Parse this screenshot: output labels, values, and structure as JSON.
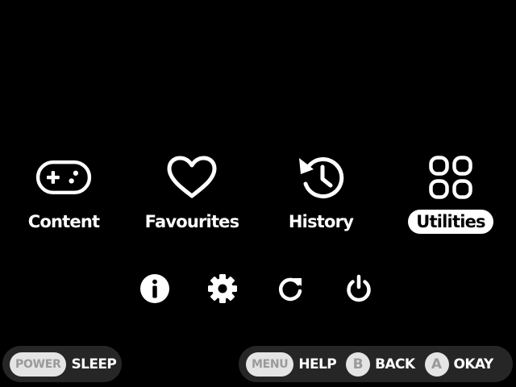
{
  "main_menu": {
    "items": [
      {
        "label": "Content",
        "icon": "gamepad-icon",
        "selected": false
      },
      {
        "label": "Favourites",
        "icon": "heart-icon",
        "selected": false
      },
      {
        "label": "History",
        "icon": "history-icon",
        "selected": false
      },
      {
        "label": "Utilities",
        "icon": "apps-grid-icon",
        "selected": true
      }
    ]
  },
  "quick_actions": [
    {
      "icon": "info-icon"
    },
    {
      "icon": "gear-icon"
    },
    {
      "icon": "refresh-icon"
    },
    {
      "icon": "power-icon"
    }
  ],
  "footer": {
    "left": {
      "key": "POWER",
      "label": "SLEEP"
    },
    "right": [
      {
        "key": "MENU",
        "label": "HELP"
      },
      {
        "key": "B",
        "label": "BACK"
      },
      {
        "key": "A",
        "label": "OKAY"
      }
    ]
  },
  "colors": {
    "background": "#000000",
    "foreground": "#ffffff",
    "footer_bar": "#262626",
    "key_bg": "#e4e4e4",
    "key_text": "#9a9a9a"
  }
}
